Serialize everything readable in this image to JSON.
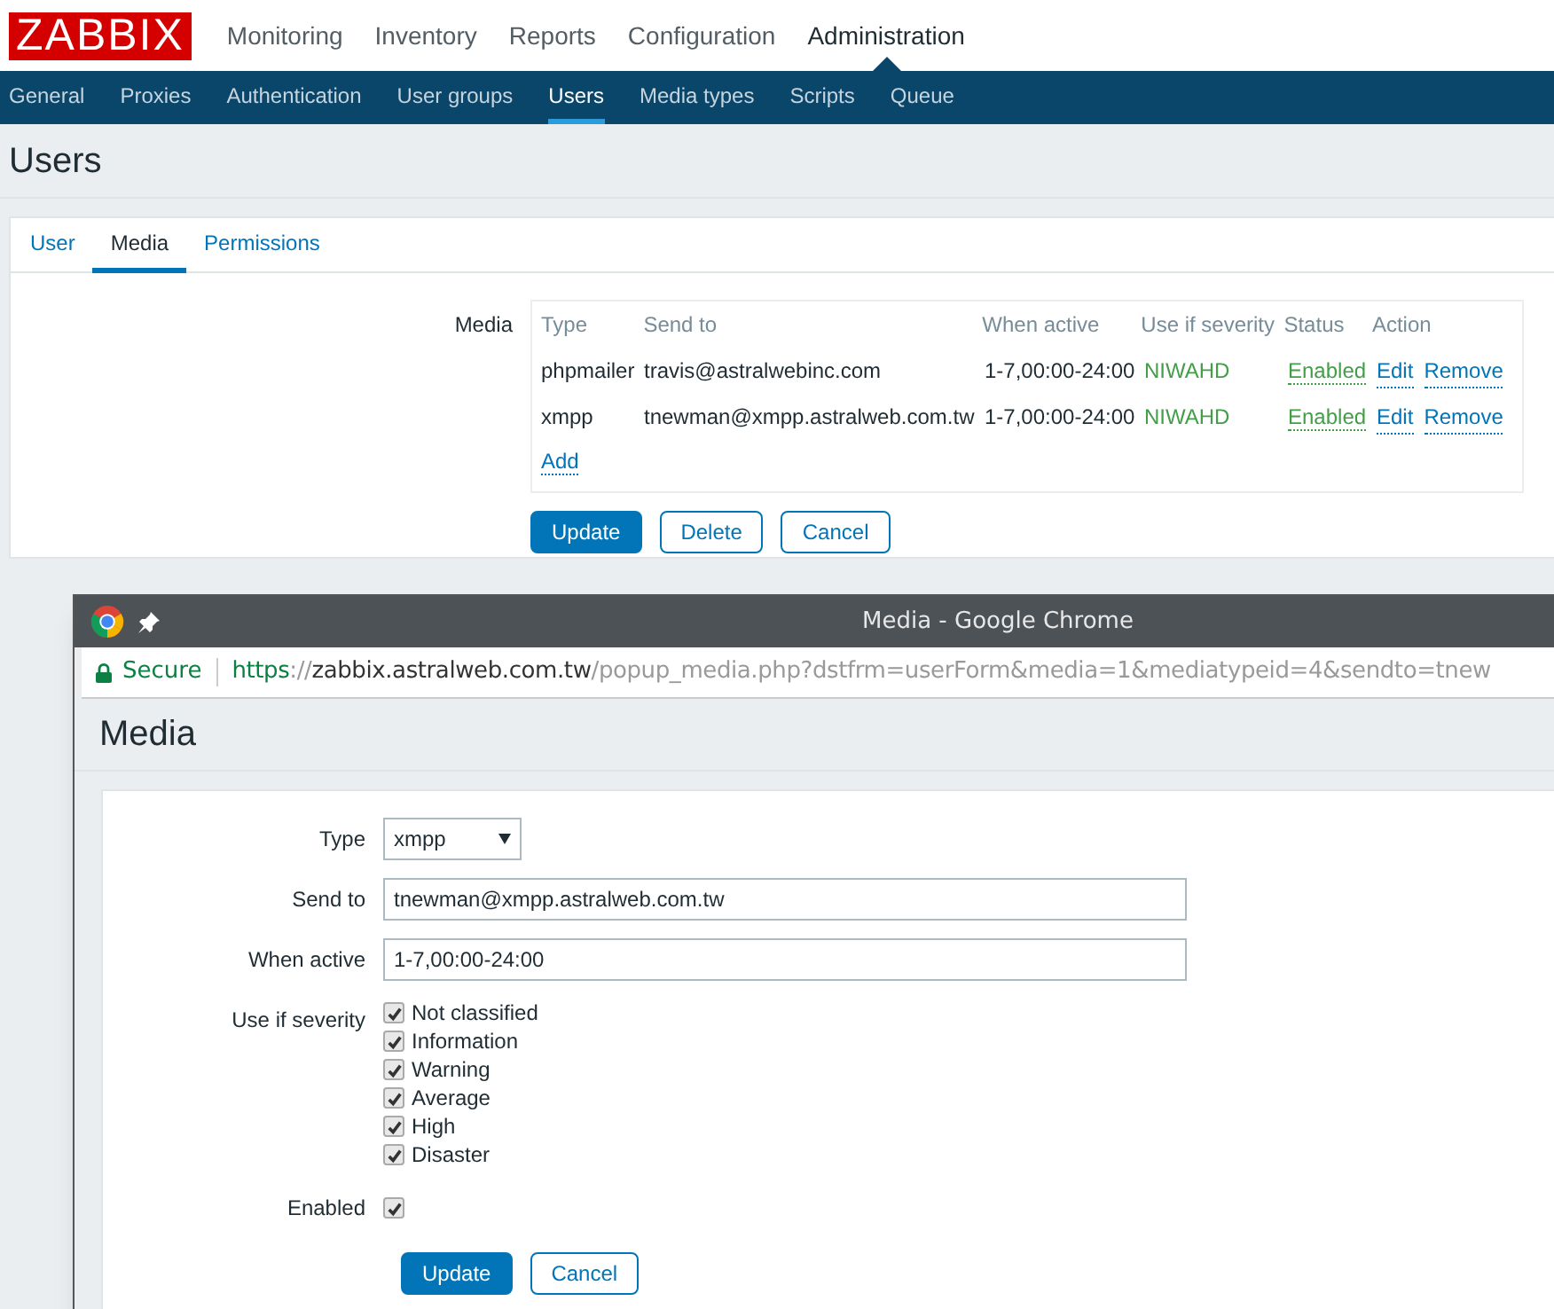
{
  "logo": "ZABBIX",
  "top_menu": [
    {
      "label": "Monitoring",
      "selected": false
    },
    {
      "label": "Inventory",
      "selected": false
    },
    {
      "label": "Reports",
      "selected": false
    },
    {
      "label": "Configuration",
      "selected": false
    },
    {
      "label": "Administration",
      "selected": true
    }
  ],
  "sub_menu": [
    {
      "label": "General",
      "selected": false
    },
    {
      "label": "Proxies",
      "selected": false
    },
    {
      "label": "Authentication",
      "selected": false
    },
    {
      "label": "User groups",
      "selected": false
    },
    {
      "label": "Users",
      "selected": true
    },
    {
      "label": "Media types",
      "selected": false
    },
    {
      "label": "Scripts",
      "selected": false
    },
    {
      "label": "Queue",
      "selected": false
    }
  ],
  "page_title": "Users",
  "tabs": [
    {
      "label": "User",
      "selected": false
    },
    {
      "label": "Media",
      "selected": true
    },
    {
      "label": "Permissions",
      "selected": false
    }
  ],
  "media": {
    "label": "Media",
    "columns": [
      "Type",
      "Send to",
      "When active",
      "Use if severity",
      "Status",
      "Action"
    ],
    "rows": [
      {
        "type": "phpmailer",
        "send_to": "travis@astralwebinc.com",
        "when_active": "1-7,00:00-24:00",
        "severity": "NIWAHD",
        "status": "Enabled",
        "edit": "Edit",
        "remove": "Remove"
      },
      {
        "type": "xmpp",
        "send_to": "tnewman@xmpp.astralweb.com.tw",
        "when_active": "1-7,00:00-24:00",
        "severity": "NIWAHD",
        "status": "Enabled",
        "edit": "Edit",
        "remove": "Remove"
      }
    ],
    "add_link": "Add"
  },
  "buttons": [
    {
      "label": "Update",
      "kind": "primary"
    },
    {
      "label": "Delete",
      "kind": "secondary"
    },
    {
      "label": "Cancel",
      "kind": "secondary"
    }
  ],
  "popup": {
    "window_title": "Media - Google Chrome",
    "secure_label": "Secure",
    "url": {
      "scheme": "https",
      "separator": "://",
      "host": "zabbix.astralweb.com.tw",
      "path": "/popup_media.php?dstfrm=userForm&media=1&mediatypeid=4&sendto=tnew"
    },
    "heading": "Media",
    "type": {
      "label": "Type",
      "value": "xmpp"
    },
    "send_to": {
      "label": "Send to",
      "value": "tnewman@xmpp.astralweb.com.tw"
    },
    "when_active": {
      "label": "When active",
      "value": "1-7,00:00-24:00"
    },
    "severity_label": "Use if severity",
    "severities": [
      {
        "label": "Not classified",
        "checked": true
      },
      {
        "label": "Information",
        "checked": true
      },
      {
        "label": "Warning",
        "checked": true
      },
      {
        "label": "Average",
        "checked": true
      },
      {
        "label": "High",
        "checked": true
      },
      {
        "label": "Disaster",
        "checked": true
      }
    ],
    "enabled": {
      "label": "Enabled",
      "checked": true
    },
    "buttons": [
      {
        "label": "Update",
        "kind": "primary"
      },
      {
        "label": "Cancel",
        "kind": "secondary"
      }
    ]
  }
}
